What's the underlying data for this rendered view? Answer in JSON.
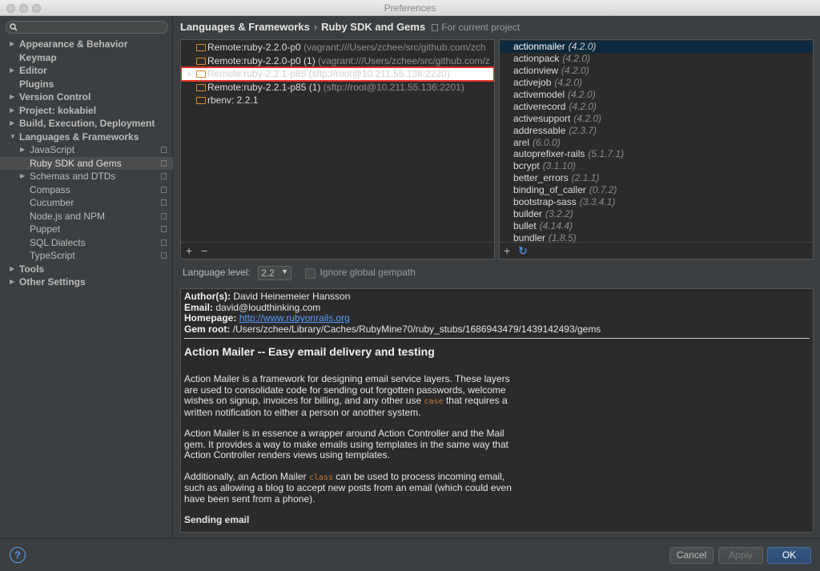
{
  "window": {
    "title": "Preferences"
  },
  "sidebar": {
    "search_placeholder": "",
    "items": [
      {
        "label": "Appearance & Behavior",
        "indent": 0,
        "bold": true,
        "arrow": true
      },
      {
        "label": "Keymap",
        "indent": 0,
        "bold": true,
        "arrow": false
      },
      {
        "label": "Editor",
        "indent": 0,
        "bold": true,
        "arrow": true
      },
      {
        "label": "Plugins",
        "indent": 0,
        "bold": true,
        "arrow": false
      },
      {
        "label": "Version Control",
        "indent": 0,
        "bold": true,
        "arrow": true
      },
      {
        "label": "Project: kokabiel",
        "indent": 0,
        "bold": true,
        "arrow": true
      },
      {
        "label": "Build, Execution, Deployment",
        "indent": 0,
        "bold": true,
        "arrow": true
      },
      {
        "label": "Languages & Frameworks",
        "indent": 0,
        "bold": true,
        "arrow": true,
        "expanded": true
      },
      {
        "label": "JavaScript",
        "indent": 1,
        "arrow": true,
        "proj": true
      },
      {
        "label": "Ruby SDK and Gems",
        "indent": 1,
        "arrow": false,
        "proj": true,
        "selected": true
      },
      {
        "label": "Schemas and DTDs",
        "indent": 1,
        "arrow": true,
        "proj": true
      },
      {
        "label": "Compass",
        "indent": 1,
        "arrow": false,
        "proj": true
      },
      {
        "label": "Cucumber",
        "indent": 1,
        "arrow": false,
        "proj": true
      },
      {
        "label": "Node.js and NPM",
        "indent": 1,
        "arrow": false,
        "proj": true
      },
      {
        "label": "Puppet",
        "indent": 1,
        "arrow": false,
        "proj": true
      },
      {
        "label": "SQL Dialects",
        "indent": 1,
        "arrow": false,
        "proj": true
      },
      {
        "label": "TypeScript",
        "indent": 1,
        "arrow": false,
        "proj": true
      },
      {
        "label": "Tools",
        "indent": 0,
        "bold": true,
        "arrow": true
      },
      {
        "label": "Other Settings",
        "indent": 0,
        "bold": true,
        "arrow": true
      }
    ]
  },
  "breadcrumb": {
    "parent": "Languages & Frameworks",
    "separator": "›",
    "current": "Ruby SDK and Gems",
    "scope": "For current project"
  },
  "sdks": [
    {
      "name": "Remote:ruby-2.2.0-p0",
      "path": "(vagrant:///Users/zchee/src/github.com/zch"
    },
    {
      "name": "Remote:ruby-2.2.0-p0 (1)",
      "path": "(vagrant:///Users/zchee/src/github.com/z"
    },
    {
      "name": "Remote:ruby-2.2.1-p85",
      "path": "(sftp://root@10.211.55.136:2220)",
      "highlighted": true
    },
    {
      "name": "Remote:ruby-2.2.1-p85 (1)",
      "path": "(sftp://root@10.211.55.136:2201)"
    },
    {
      "name": "rbenv: 2.2.1",
      "path": ""
    }
  ],
  "gems": [
    {
      "name": "actionmailer",
      "version": "(4.2.0)",
      "selected": true
    },
    {
      "name": "actionpack",
      "version": "(4.2.0)"
    },
    {
      "name": "actionview",
      "version": "(4.2.0)"
    },
    {
      "name": "activejob",
      "version": "(4.2.0)"
    },
    {
      "name": "activemodel",
      "version": "(4.2.0)"
    },
    {
      "name": "activerecord",
      "version": "(4.2.0)"
    },
    {
      "name": "activesupport",
      "version": "(4.2.0)"
    },
    {
      "name": "addressable",
      "version": "(2.3.7)"
    },
    {
      "name": "arel",
      "version": "(6.0.0)"
    },
    {
      "name": "autoprefixer-rails",
      "version": "(5.1.7.1)"
    },
    {
      "name": "bcrypt",
      "version": "(3.1.10)"
    },
    {
      "name": "better_errors",
      "version": "(2.1.1)"
    },
    {
      "name": "binding_of_caller",
      "version": "(0.7.2)"
    },
    {
      "name": "bootstrap-sass",
      "version": "(3.3.4.1)"
    },
    {
      "name": "builder",
      "version": "(3.2.2)"
    },
    {
      "name": "bullet",
      "version": "(4.14.4)"
    },
    {
      "name": "bundler",
      "version": "(1.8.5)"
    }
  ],
  "toolbar": {
    "add": "+",
    "remove": "−",
    "add2": "+",
    "refresh": "↻"
  },
  "language_level": {
    "label": "Language level:",
    "value": "2.2",
    "ignore_label": "Ignore global gempath"
  },
  "details": {
    "author_label": "Author(s):",
    "author": "David Heinemeier Hansson",
    "email_label": "Email:",
    "email": "david@loudthinking.com",
    "homepage_label": "Homepage:",
    "homepage": "http://www.rubyonrails.org",
    "gemroot_label": "Gem root:",
    "gemroot": "/Users/zchee/Library/Caches/RubyMine70/ruby_stubs/1686943479/1439142493/gems",
    "title": "Action Mailer -- Easy email delivery and testing",
    "p1a": "Action Mailer is a framework for designing email service layers. These layers are used to consolidate code for sending out forgotten passwords, welcome wishes on signup, invoices for billing, and any other use ",
    "p1code": "case",
    "p1b": " that requires a written notification to either a person or another system.",
    "p2": "Action Mailer is in essence a wrapper around Action Controller and the Mail gem. It provides a way to make emails using templates in the same way that Action Controller renders views using templates.",
    "p3a": "Additionally, an Action Mailer ",
    "p3code": "class",
    "p3b": " can be used to process incoming email, such as allowing a blog to accept new posts from an email (which could even have been sent from a phone).",
    "cut": "Sending email"
  },
  "buttons": {
    "help": "?",
    "cancel": "Cancel",
    "apply": "Apply",
    "ok": "OK"
  }
}
